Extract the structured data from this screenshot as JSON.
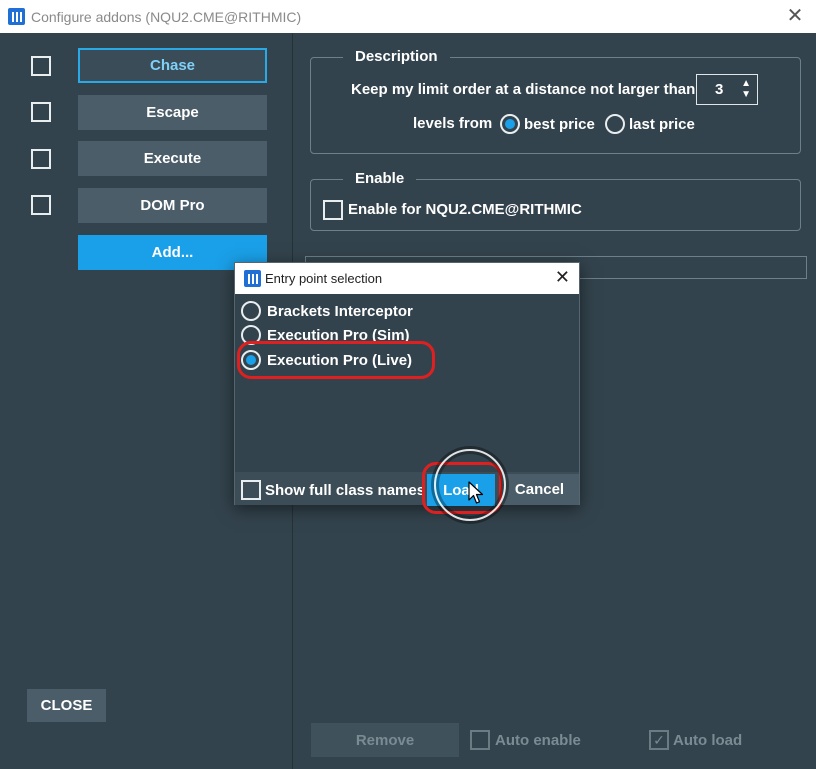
{
  "window": {
    "title": "Configure addons (NQU2.CME@RITHMIC)",
    "close_glyph": "✕"
  },
  "addons": [
    {
      "label": "Chase",
      "selected": true
    },
    {
      "label": "Escape",
      "selected": false
    },
    {
      "label": "Execute",
      "selected": false
    },
    {
      "label": "DOM Pro",
      "selected": false
    }
  ],
  "add_label": "Add...",
  "close_label": "CLOSE",
  "description": {
    "title": "Description",
    "line1": "Keep my limit order at a distance not larger than",
    "levels": "3",
    "line2_prefix": "levels from",
    "option_best": "best price",
    "option_last": "last price",
    "selected": "best price"
  },
  "enable": {
    "title": "Enable",
    "checkbox_label": "Enable for NQU2.CME@RITHMIC",
    "checked": false
  },
  "bottom": {
    "remove_label": "Remove",
    "auto_enable_label": "Auto enable",
    "auto_load_label": "Auto load",
    "auto_load_checked": true
  },
  "dialog": {
    "title": "Entry point selection",
    "close_glyph": "✕",
    "items": [
      {
        "label": "Brackets Interceptor",
        "selected": false
      },
      {
        "label": "Execution Pro (Sim)",
        "selected": false
      },
      {
        "label": "Execution Pro (Live)",
        "selected": true
      }
    ],
    "show_full_class_names": "Show full class names",
    "load_label": "Load",
    "cancel_label": "Cancel"
  },
  "colors": {
    "accent": "#1aa0e8",
    "background": "#33434d",
    "highlight": "#e02020"
  }
}
